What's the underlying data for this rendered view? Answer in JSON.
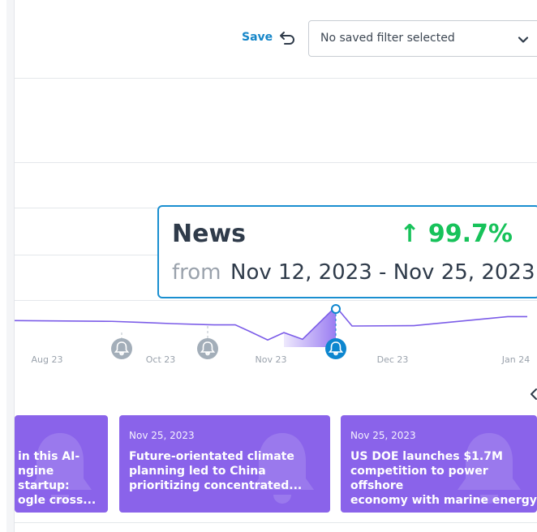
{
  "toolbar": {
    "save_label": "Save",
    "filter_value": "No saved filter selected"
  },
  "timeline": {
    "tick_labels": [
      "Aug 23",
      "Oct 23",
      "Nov 23",
      "Dec 23",
      "Jan 24"
    ],
    "series": [
      0.36,
      0.41,
      0.47,
      0.47,
      0.64,
      0.86,
      0.67,
      0.84,
      0.0,
      0.5,
      0.49,
      0.26,
      0.26
    ],
    "highlight_index": 8,
    "colors": {
      "line": "#7b5ce8",
      "fill": "#8f6ef0",
      "marker_active": "#0d86cf",
      "marker_inactive": "#a3aeb9"
    }
  },
  "tooltip": {
    "title": "News",
    "change": "↑ 99.7%",
    "from_label": "from",
    "range": "Nov 12, 2023 - Nov 25, 2023"
  },
  "cards": [
    {
      "date": "",
      "title": "in this AI-\nngine startup:\nogle cross..."
    },
    {
      "date": "Nov 25, 2023",
      "title": "Future-orientated climate\nplanning led to China\nprioritizing concentrated..."
    },
    {
      "date": "Nov 25, 2023",
      "title": "US DOE launches $1.7M\ncompetition to power offshore\neconomy with marine energy"
    }
  ],
  "icons": {
    "undo": "undo-icon",
    "chevron": "chevron-down-icon",
    "bell": "bell-icon",
    "next": "chevron-left-icon"
  },
  "colors": {
    "accent": "#1686c8",
    "card": "#8a63ea",
    "positive": "#17c25a"
  }
}
